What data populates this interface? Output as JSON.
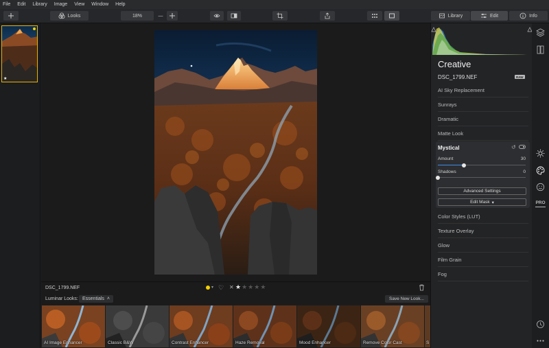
{
  "menu": [
    "File",
    "Edit",
    "Library",
    "Image",
    "View",
    "Window",
    "Help"
  ],
  "toolbar": {
    "looks_label": "Looks",
    "zoom": "18%",
    "zoom_minus": "—",
    "library_label": "Library",
    "edit_label": "Edit",
    "info_label": "Info"
  },
  "image": {
    "filename": "DSC_1799.NEF",
    "rating": 1,
    "max_rating": 5,
    "flag_color": "#f3cf00"
  },
  "looks_bar": {
    "label": "Luminar Looks:",
    "collection": "Essentials",
    "save_button": "Save New Look...",
    "items": [
      "AI Image Enhancer",
      "Classic B&W",
      "Contrast Enhancer",
      "Haze Removal",
      "Mood Enhancer",
      "Remove Color Cast",
      "S"
    ]
  },
  "panel": {
    "title": "Creative",
    "filename": "DSC_1799.NEF",
    "raw_badge": "RAW",
    "items_above": [
      "AI Sky Replacement",
      "Sunrays",
      "Dramatic",
      "Matte Look"
    ],
    "active": {
      "title": "Mystical",
      "amount_label": "Amount",
      "amount_value": "30",
      "amount_fraction": 0.3,
      "shadows_label": "Shadows",
      "shadows_value": "0",
      "shadows_fraction": 0.0,
      "advanced_button": "Advanced Settings",
      "mask_button": "Edit Mask"
    },
    "items_below": [
      "Color Styles (LUT)",
      "Texture Overlay",
      "Glow",
      "Film Grain",
      "Fog"
    ]
  },
  "tools": {
    "pro_label": "PRO"
  },
  "colors": {
    "accent": "#3c8ee6",
    "selection": "#e8b400"
  }
}
